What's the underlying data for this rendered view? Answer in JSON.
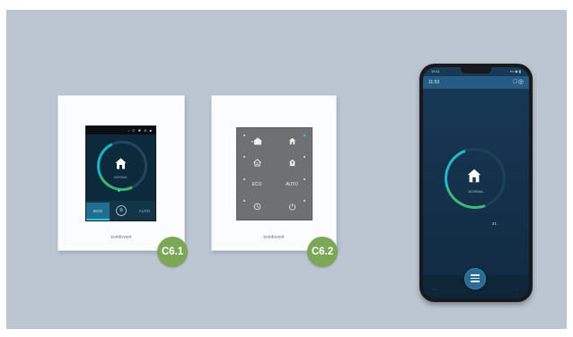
{
  "touch_panel": {
    "brand": "komfovent",
    "status_right": "• ∅ ✱ ⊕ ■",
    "mode": "NORMAL",
    "eco_label": "ECO",
    "off_symbol": "⊗",
    "auto_label": "AUTO",
    "badge": "C6.1"
  },
  "button_panel": {
    "brand": "komfovent",
    "buttons": [
      {
        "label": "ᐩ",
        "icon": "home-away-icon"
      },
      {
        "label": "",
        "icon": "home-icon"
      },
      {
        "label": "",
        "icon": "home-intensive-icon"
      },
      {
        "label": "",
        "icon": "home-boost-icon"
      },
      {
        "label": "ECO",
        "icon": ""
      },
      {
        "label": "AUTO",
        "icon": ""
      },
      {
        "label": "",
        "icon": "clock-icon"
      },
      {
        "label": "",
        "icon": "power-icon"
      }
    ],
    "badge": "C6.2"
  },
  "phone": {
    "status_time": "19:11",
    "status_signal": "▪▪▪ ◉ ▮",
    "header_time": "11:53",
    "header_icons": "□◎",
    "mode": "NORMAL",
    "temp": "21",
    "nav_left": "◦◦◦",
    "nav_right": "◦◦◦"
  },
  "colors": {
    "background": "#bcc6d3",
    "badge": "#7ba756",
    "accent_cyan": "#1ecfe0",
    "phone_header": "#255c84"
  }
}
